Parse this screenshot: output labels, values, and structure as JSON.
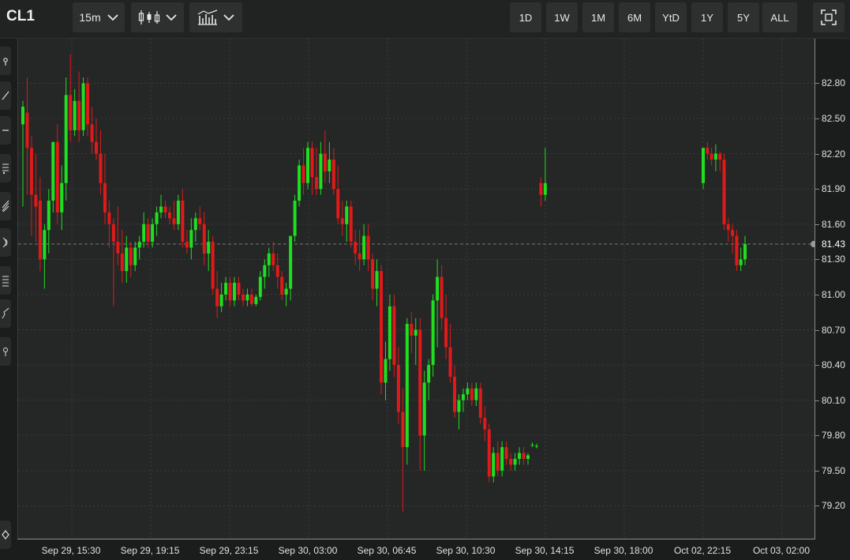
{
  "toolbar": {
    "symbol": "CL1",
    "interval": "15m",
    "ranges": [
      "1D",
      "1W",
      "1M",
      "6M",
      "YtD",
      "1Y",
      "5Y",
      "ALL"
    ],
    "icons": [
      "candlestick-type-icon",
      "indicators-icon",
      "fullscreen-icon"
    ]
  },
  "left_rail": {
    "icons": [
      "crosshair-tool-icon",
      "trendline-tool-icon",
      "horizontal-line-tool-icon",
      "fibonacci-tool-icon",
      "pitchfork-tool-icon",
      "gann-tool-icon",
      "pattern-tool-icon",
      "elliott-wave-tool-icon",
      "measure-tool-icon",
      "eraser-tool-icon"
    ]
  },
  "colors": {
    "up": "#1fe01f",
    "down": "#e01a1a",
    "background": "#252626",
    "grid": "#3a3b3b",
    "last_price_line": "#777777"
  },
  "chart_data": {
    "type": "candlestick",
    "interval": "15m",
    "last_price": 81.43,
    "y_ticks": [
      79.2,
      79.5,
      79.8,
      80.1,
      80.4,
      80.7,
      81.0,
      81.3,
      81.6,
      81.9,
      82.2,
      82.5,
      82.8
    ],
    "y_tick_labels": [
      "79.20",
      "79.50",
      "79.80",
      "80.10",
      "80.40",
      "80.70",
      "81.00",
      "81.30",
      "81.60",
      "81.90",
      "82.20",
      "82.50",
      "82.80"
    ],
    "last_price_label": "81.43",
    "x_tick_labels": [
      "Sep 29, 15:30",
      "Sep 29, 19:15",
      "Sep 29, 23:15",
      "Sep 30, 03:00",
      "Sep 30, 06:45",
      "Sep 30, 10:30",
      "Sep 30, 14:15",
      "Sep 30, 18:00",
      "Oct 02, 22:15",
      "Oct 03, 02:00"
    ],
    "ylim": [
      78.92,
      83.18
    ],
    "grid": true,
    "candles": [
      [
        82.45,
        82.65,
        81.75,
        82.6
      ],
      [
        82.55,
        82.85,
        81.85,
        82.25
      ],
      [
        82.25,
        82.35,
        81.5,
        81.85
      ],
      [
        81.85,
        82.2,
        81.45,
        81.75
      ],
      [
        81.8,
        82.0,
        81.2,
        81.3
      ],
      [
        81.3,
        81.6,
        81.05,
        81.55
      ],
      [
        81.55,
        81.9,
        81.35,
        81.8
      ],
      [
        81.8,
        82.3,
        81.7,
        82.3
      ],
      [
        82.3,
        82.45,
        81.6,
        81.7
      ],
      [
        81.7,
        82.1,
        81.55,
        81.95
      ],
      [
        81.95,
        82.85,
        81.8,
        82.7
      ],
      [
        82.7,
        83.05,
        82.3,
        82.4
      ],
      [
        82.4,
        82.75,
        82.35,
        82.65
      ],
      [
        82.65,
        82.9,
        82.3,
        82.4
      ],
      [
        82.4,
        82.85,
        82.35,
        82.8
      ],
      [
        82.8,
        82.85,
        82.35,
        82.45
      ],
      [
        82.45,
        82.6,
        82.2,
        82.3
      ],
      [
        82.3,
        82.5,
        82.15,
        82.2
      ],
      [
        82.2,
        82.4,
        81.85,
        81.95
      ],
      [
        81.95,
        82.2,
        81.6,
        81.7
      ],
      [
        81.7,
        81.8,
        81.4,
        81.6
      ],
      [
        81.6,
        81.65,
        80.9,
        81.45
      ],
      [
        81.45,
        81.75,
        81.25,
        81.35
      ],
      [
        81.35,
        81.55,
        81.1,
        81.2
      ],
      [
        81.2,
        81.5,
        81.1,
        81.4
      ],
      [
        81.4,
        81.45,
        81.15,
        81.25
      ],
      [
        81.25,
        81.45,
        81.2,
        81.4
      ],
      [
        81.4,
        81.5,
        81.3,
        81.45
      ],
      [
        81.45,
        81.7,
        81.4,
        81.6
      ],
      [
        81.6,
        81.65,
        81.4,
        81.45
      ],
      [
        81.45,
        81.65,
        81.4,
        81.6
      ],
      [
        81.6,
        81.75,
        81.5,
        81.7
      ],
      [
        81.7,
        81.85,
        81.65,
        81.75
      ],
      [
        81.75,
        81.8,
        81.65,
        81.7
      ],
      [
        81.7,
        81.75,
        81.6,
        81.65
      ],
      [
        81.65,
        81.8,
        81.55,
        81.6
      ],
      [
        81.6,
        81.85,
        81.55,
        81.8
      ],
      [
        81.8,
        81.9,
        81.4,
        81.45
      ],
      [
        81.45,
        81.55,
        81.35,
        81.4
      ],
      [
        81.4,
        81.65,
        81.3,
        81.55
      ],
      [
        81.55,
        81.7,
        81.45,
        81.65
      ],
      [
        81.65,
        81.75,
        81.55,
        81.6
      ],
      [
        81.6,
        81.7,
        81.25,
        81.35
      ],
      [
        81.35,
        81.55,
        81.2,
        81.45
      ],
      [
        81.45,
        81.5,
        81.0,
        81.05
      ],
      [
        81.05,
        81.2,
        80.8,
        80.9
      ],
      [
        80.9,
        81.1,
        80.85,
        81.0
      ],
      [
        81.0,
        81.15,
        80.95,
        81.1
      ],
      [
        81.1,
        81.15,
        80.9,
        80.95
      ],
      [
        80.95,
        81.15,
        80.9,
        81.1
      ],
      [
        81.1,
        81.15,
        80.95,
        81.0
      ],
      [
        81.0,
        81.05,
        80.9,
        80.95
      ],
      [
        80.95,
        81.05,
        80.9,
        81.0
      ],
      [
        81.0,
        81.05,
        80.9,
        80.92
      ],
      [
        80.92,
        81.0,
        80.9,
        80.98
      ],
      [
        80.98,
        81.2,
        80.95,
        81.15
      ],
      [
        81.15,
        81.3,
        81.05,
        81.25
      ],
      [
        81.25,
        81.4,
        81.15,
        81.35
      ],
      [
        81.35,
        81.45,
        81.2,
        81.25
      ],
      [
        81.25,
        81.35,
        81.05,
        81.15
      ],
      [
        81.15,
        81.2,
        80.95,
        81.0
      ],
      [
        81.0,
        81.1,
        80.9,
        81.05
      ],
      [
        81.05,
        81.5,
        80.95,
        81.5
      ],
      [
        81.5,
        81.85,
        81.45,
        81.8
      ],
      [
        81.8,
        82.15,
        81.75,
        82.1
      ],
      [
        82.1,
        82.25,
        81.85,
        81.95
      ],
      [
        81.95,
        82.3,
        81.9,
        82.25
      ],
      [
        82.25,
        82.3,
        81.85,
        82.0
      ],
      [
        82.0,
        82.25,
        81.85,
        81.9
      ],
      [
        81.9,
        82.3,
        81.85,
        82.2
      ],
      [
        82.2,
        82.4,
        81.95,
        82.05
      ],
      [
        82.05,
        82.3,
        81.95,
        82.15
      ],
      [
        82.15,
        82.25,
        81.85,
        81.9
      ],
      [
        81.9,
        82.1,
        81.6,
        81.65
      ],
      [
        81.65,
        81.8,
        81.5,
        81.6
      ],
      [
        81.6,
        81.8,
        81.45,
        81.75
      ],
      [
        81.75,
        81.8,
        81.4,
        81.45
      ],
      [
        81.45,
        81.55,
        81.25,
        81.35
      ],
      [
        81.35,
        81.55,
        81.2,
        81.3
      ],
      [
        81.3,
        81.6,
        81.25,
        81.5
      ],
      [
        81.5,
        81.6,
        81.2,
        81.3
      ],
      [
        81.3,
        81.35,
        80.95,
        81.05
      ],
      [
        81.05,
        81.3,
        80.9,
        81.2
      ],
      [
        81.2,
        81.25,
        80.15,
        80.25
      ],
      [
        80.25,
        80.6,
        80.1,
        80.45
      ],
      [
        80.45,
        81.0,
        80.35,
        80.9
      ],
      [
        80.9,
        81.0,
        80.3,
        80.4
      ],
      [
        80.4,
        80.55,
        79.9,
        80.0
      ],
      [
        80.0,
        80.2,
        79.15,
        79.7
      ],
      [
        79.7,
        80.8,
        79.55,
        80.75
      ],
      [
        80.75,
        80.85,
        80.5,
        80.65
      ],
      [
        80.65,
        80.8,
        80.4,
        80.7
      ],
      [
        80.7,
        80.8,
        79.5,
        79.8
      ],
      [
        79.8,
        80.35,
        79.5,
        80.25
      ],
      [
        80.25,
        80.45,
        80.1,
        80.4
      ],
      [
        80.4,
        81.0,
        80.3,
        80.95
      ],
      [
        80.95,
        81.3,
        80.55,
        81.15
      ],
      [
        81.15,
        81.25,
        80.7,
        80.8
      ],
      [
        80.8,
        81.0,
        80.45,
        80.55
      ],
      [
        80.55,
        80.75,
        80.25,
        80.3
      ],
      [
        80.3,
        80.4,
        79.95,
        80.0
      ],
      [
        80.0,
        80.15,
        79.85,
        80.1
      ],
      [
        80.1,
        80.2,
        80.0,
        80.15
      ],
      [
        80.15,
        80.25,
        80.1,
        80.2
      ],
      [
        80.2,
        80.25,
        80.05,
        80.1
      ],
      [
        80.1,
        80.25,
        80.05,
        80.2
      ],
      [
        80.2,
        80.25,
        79.9,
        79.95
      ],
      [
        79.95,
        80.05,
        79.75,
        79.85
      ],
      [
        79.85,
        79.9,
        79.4,
        79.45
      ],
      [
        79.45,
        79.7,
        79.4,
        79.65
      ],
      [
        79.65,
        79.75,
        79.45,
        79.5
      ],
      [
        79.5,
        79.75,
        79.45,
        79.7
      ],
      [
        79.7,
        79.75,
        79.55,
        79.6
      ],
      [
        79.6,
        79.65,
        79.5,
        79.55
      ],
      [
        79.55,
        79.65,
        79.5,
        79.6
      ],
      [
        79.6,
        79.7,
        79.55,
        79.65
      ],
      [
        79.65,
        79.7,
        79.55,
        79.6
      ],
      [
        79.6,
        79.65,
        79.55,
        79.63
      ],
      [
        79.72,
        79.74,
        79.7,
        79.72
      ],
      [
        79.71,
        79.73,
        79.69,
        79.71
      ],
      [
        81.95,
        82.0,
        81.75,
        81.85
      ],
      [
        81.85,
        82.25,
        81.8,
        81.95
      ],
      [
        81.95,
        82.25,
        81.9,
        82.25
      ],
      [
        82.25,
        82.3,
        82.15,
        82.2
      ],
      [
        82.2,
        82.25,
        82.1,
        82.15
      ],
      [
        82.15,
        82.28,
        82.05,
        82.2
      ],
      [
        82.2,
        82.22,
        82.05,
        82.15
      ],
      [
        82.15,
        82.2,
        81.55,
        81.6
      ],
      [
        81.6,
        81.65,
        81.45,
        81.55
      ],
      [
        81.55,
        81.6,
        81.35,
        81.5
      ],
      [
        81.5,
        81.55,
        81.2,
        81.25
      ],
      [
        81.25,
        81.4,
        81.2,
        81.3
      ],
      [
        81.3,
        81.5,
        81.25,
        81.43
      ]
    ]
  }
}
